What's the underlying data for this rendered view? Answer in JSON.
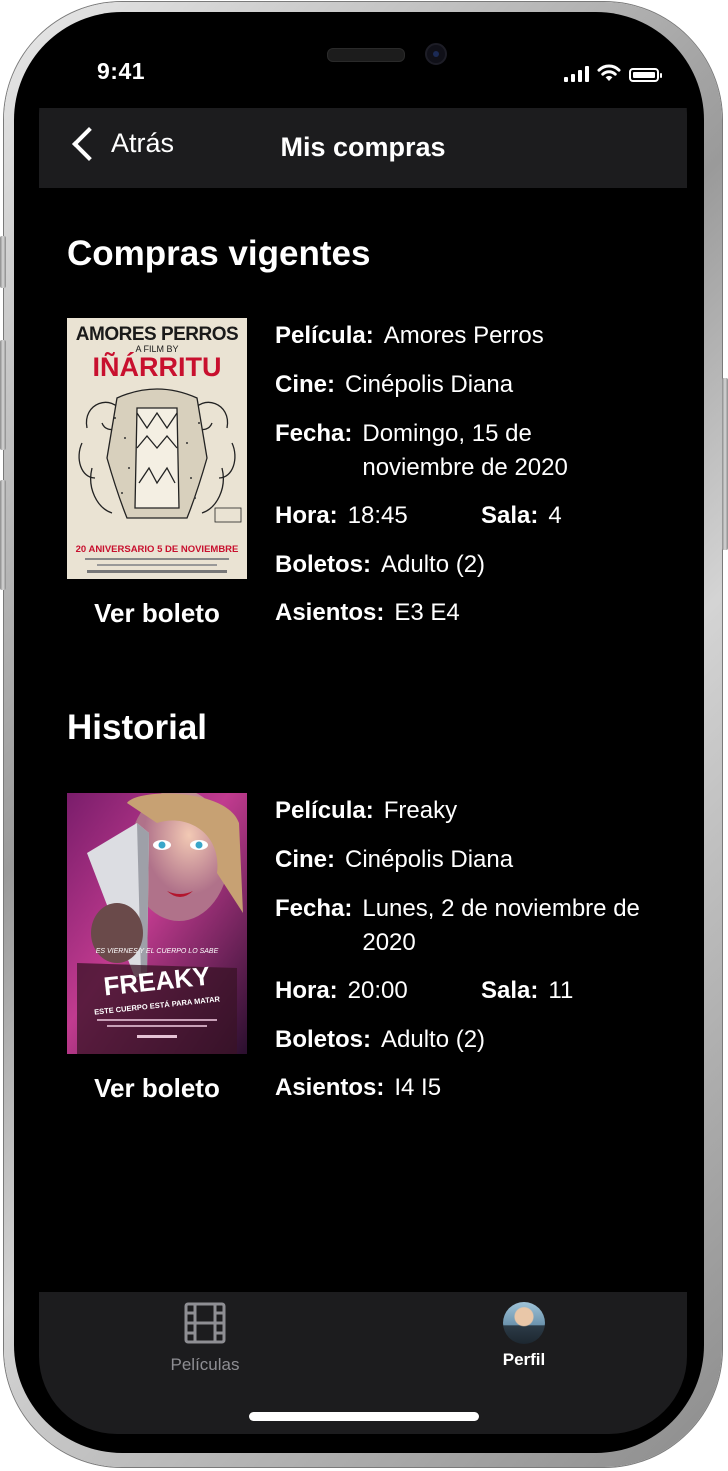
{
  "status_bar": {
    "time": "9:41"
  },
  "nav": {
    "back_label": "Atrás",
    "title": "Mis compras"
  },
  "sections": {
    "current_title": "Compras vigentes",
    "history_title": "Historial"
  },
  "labels": {
    "pelicula": "Película:",
    "cine": "Cine:",
    "fecha": "Fecha:",
    "hora": "Hora:",
    "sala": "Sala:",
    "boletos": "Boletos:",
    "asientos": "Asientos:",
    "ver_boleto": "Ver boleto"
  },
  "current_purchase": {
    "pelicula": "Amores Perros",
    "cine": "Cinépolis Diana",
    "fecha": "Domingo, 15 de noviembre de 2020",
    "hora": "18:45",
    "sala": "4",
    "boletos": "Adulto (2)",
    "asientos": "E3 E4",
    "poster": {
      "title": "AMORES PERROS",
      "subtitle": "A FILM BY",
      "director": "IÑÁRRITU",
      "footer": "20 ANIVERSARIO  5 DE NOVIEMBRE"
    }
  },
  "history_purchase": {
    "pelicula": "Freaky",
    "cine": "Cinépolis Diana",
    "fecha": "Lunes, 2 de noviembre de 2020",
    "hora": "20:00",
    "sala": "11",
    "boletos": "Adulto (2)",
    "asientos": "I4 I5",
    "poster": {
      "tagline": "ES VIERNES Y EL CUERPO LO SABE",
      "title": "FREAKY",
      "subtitle": "ESTE CUERPO ESTÁ PARA MATAR"
    }
  },
  "tabbar": {
    "peliculas_label": "Películas",
    "perfil_label": "Perfil",
    "inactive_color": "#8e8e93",
    "active_color": "#ffffff"
  },
  "colors": {
    "background": "#000000",
    "bar_background": "#1c1c1e",
    "poster_red": "#c8102e"
  }
}
